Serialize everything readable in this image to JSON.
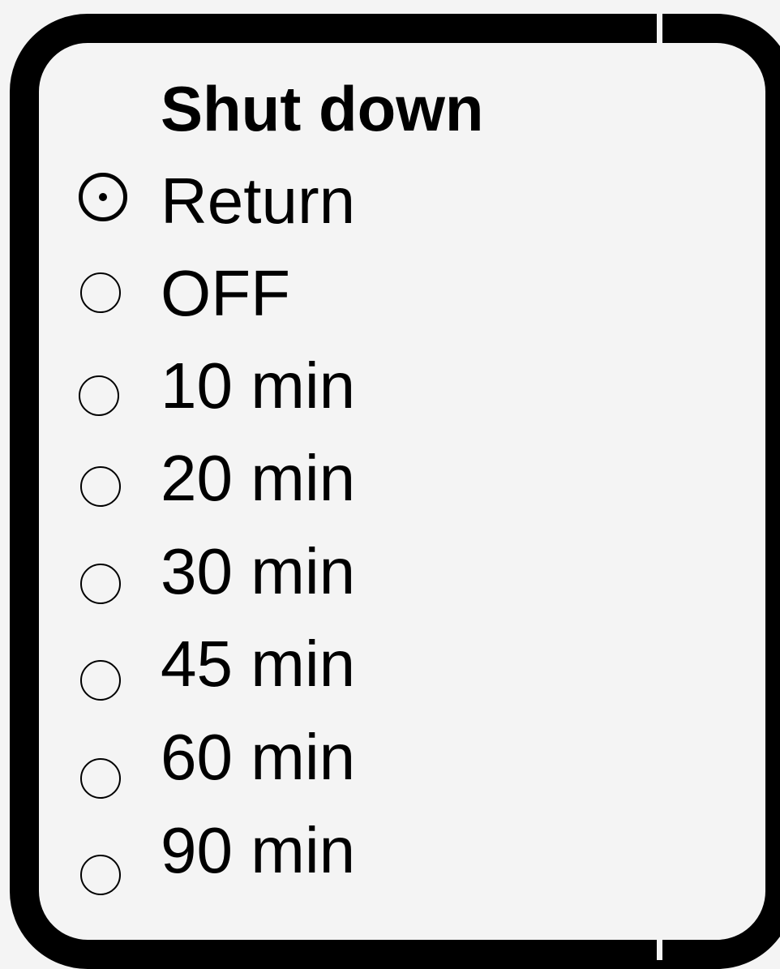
{
  "dialog": {
    "title": "Shut down",
    "selected_index": 0,
    "options": [
      {
        "label": "Return",
        "selected": true
      },
      {
        "label": "OFF",
        "selected": false
      },
      {
        "label": "10 min",
        "selected": false
      },
      {
        "label": "20 min",
        "selected": false
      },
      {
        "label": "30 min",
        "selected": false
      },
      {
        "label": "45 min",
        "selected": false
      },
      {
        "label": "60 min",
        "selected": false
      },
      {
        "label": "90 min",
        "selected": false
      }
    ]
  },
  "colors": {
    "background": "#f4f4f4",
    "frame": "#000000",
    "text": "#000000"
  },
  "icons": {
    "selected": "radio-selected-icon",
    "unselected": "radio-unselected-icon"
  }
}
